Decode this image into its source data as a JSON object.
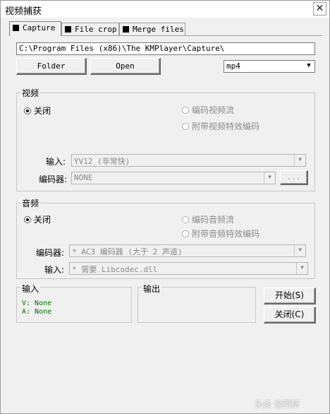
{
  "window": {
    "title": "视频捕获",
    "close_glyph": "✕"
  },
  "tabs": [
    {
      "label": "Capture",
      "active": true
    },
    {
      "label": "File crop",
      "active": false
    },
    {
      "label": "Merge files",
      "active": false
    }
  ],
  "path": {
    "value": "C:\\Program Files (x86)\\The KMPlayer\\Capture\\"
  },
  "buttons": {
    "folder": "Folder",
    "open": "Open",
    "start": "开始(S)",
    "close": "关闭(C)",
    "browse": "..."
  },
  "format": {
    "selected": "mp4"
  },
  "video": {
    "legend": "视频",
    "off": "关闭",
    "encode_stream": "编码视频流",
    "with_effects": "附带视频特效编码",
    "input_label": "输入:",
    "input_value": "YV12 (非常快)",
    "encoder_label": "编码器:",
    "encoder_value": "NONE"
  },
  "audio": {
    "legend": "音频",
    "off": "关闭",
    "encode_stream": "编码音频流",
    "with_effects": "附带音频特效编码",
    "encoder_label": "编码器:",
    "encoder_value": "* AC3 编码器 (大于 2 声道)",
    "input_label": "输入:",
    "input_value": "* 需要 Libcodec.dll"
  },
  "input_box": {
    "legend": "输入",
    "v": "V: None",
    "a": "A: None"
  },
  "output_box": {
    "legend": "输出"
  },
  "watermark": "头条 @阿斯",
  "colors": {
    "status_green": "#007000",
    "background": "#f0f0f0"
  }
}
